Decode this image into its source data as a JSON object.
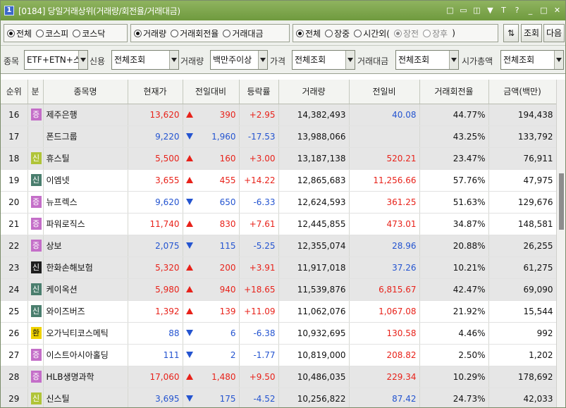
{
  "title": {
    "num": "1",
    "text": "[0184] 당일거래상위(거래량/회전율/거래대금)"
  },
  "title_icons": [
    "□",
    "▭",
    "◫",
    "▼",
    "T",
    "?",
    "_",
    "□",
    "✕"
  ],
  "market_radios": [
    {
      "label": "전체",
      "checked": true
    },
    {
      "label": "코스피",
      "checked": false
    },
    {
      "label": "코스닥",
      "checked": false
    }
  ],
  "sort_radios": [
    {
      "label": "거래량",
      "checked": true
    },
    {
      "label": "거래회전율",
      "checked": false
    },
    {
      "label": "거래대금",
      "checked": false
    }
  ],
  "session_radios": [
    {
      "label": "전체",
      "checked": true
    },
    {
      "label": "장중",
      "checked": false
    },
    {
      "label": "시간외(",
      "checked": false
    }
  ],
  "afterhours_radios": [
    {
      "label": "장전",
      "checked": true
    },
    {
      "label": "장후",
      "checked": false
    }
  ],
  "afterhours_close": ")",
  "buttons": {
    "sort": "⇅",
    "query": "조회",
    "next": "다음"
  },
  "filters": {
    "stock_label": "종목",
    "stock_value": "ETF+ETN+스",
    "credit_label": "신용",
    "credit_value": "전체조회",
    "volume_label": "거래량",
    "volume_value": "백만주이상",
    "price_label": "가격",
    "price_value": "전체조회",
    "amount_label": "거래대금",
    "amount_value": "전체조회",
    "cap_label": "시가총액",
    "cap_value": "전체조회"
  },
  "columns": [
    "순위",
    "분",
    "종목명",
    "현재가",
    "전일대비",
    "등락률",
    "거래량",
    "전일비",
    "거래회전율",
    "금액(백만)"
  ],
  "rows": [
    {
      "rank": "16",
      "badge": "증",
      "badge_type": "jeung",
      "name": "제주은행",
      "price": "13,620",
      "dir": "up",
      "change": "390",
      "rate": "+2.95",
      "volume": "14,382,493",
      "prev": "40.08",
      "prev_dir": "dn",
      "turnover": "44.77%",
      "amount": "194,438",
      "shade": "g"
    },
    {
      "rank": "17",
      "badge": "",
      "badge_type": "",
      "name": "폰드그룹",
      "price": "9,220",
      "dir": "dn",
      "change": "1,960",
      "rate": "-17.53",
      "volume": "13,988,066",
      "prev": "",
      "prev_dir": "",
      "turnover": "43.25%",
      "amount": "133,792",
      "shade": "g"
    },
    {
      "rank": "18",
      "badge": "신",
      "badge_type": "sin3",
      "name": "휴스틸",
      "price": "5,500",
      "dir": "up",
      "change": "160",
      "rate": "+3.00",
      "volume": "13,187,138",
      "prev": "520.21",
      "prev_dir": "up",
      "turnover": "23.47%",
      "amount": "76,911",
      "shade": "g"
    },
    {
      "rank": "19",
      "badge": "신",
      "badge_type": "sin",
      "name": "이엠넷",
      "price": "3,655",
      "dir": "up",
      "change": "455",
      "rate": "+14.22",
      "volume": "12,865,683",
      "prev": "11,256.66",
      "prev_dir": "up",
      "turnover": "57.76%",
      "amount": "47,975",
      "shade": "w"
    },
    {
      "rank": "20",
      "badge": "증",
      "badge_type": "jeung",
      "name": "뉴프렉스",
      "price": "9,620",
      "dir": "dn",
      "change": "650",
      "rate": "-6.33",
      "volume": "12,624,593",
      "prev": "361.25",
      "prev_dir": "up",
      "turnover": "51.63%",
      "amount": "129,676",
      "shade": "w"
    },
    {
      "rank": "21",
      "badge": "증",
      "badge_type": "jeung",
      "name": "파워로직스",
      "price": "11,740",
      "dir": "up",
      "change": "830",
      "rate": "+7.61",
      "volume": "12,445,855",
      "prev": "473.01",
      "prev_dir": "up",
      "turnover": "34.87%",
      "amount": "148,581",
      "shade": "w"
    },
    {
      "rank": "22",
      "badge": "증",
      "badge_type": "jeung",
      "name": "상보",
      "price": "2,075",
      "dir": "dn",
      "change": "115",
      "rate": "-5.25",
      "volume": "12,355,074",
      "prev": "28.96",
      "prev_dir": "dn",
      "turnover": "20.88%",
      "amount": "26,255",
      "shade": "g"
    },
    {
      "rank": "23",
      "badge": "신",
      "badge_type": "sin2",
      "name": "한화손해보험",
      "price": "5,320",
      "dir": "up",
      "change": "200",
      "rate": "+3.91",
      "volume": "11,917,018",
      "prev": "37.26",
      "prev_dir": "dn",
      "turnover": "10.21%",
      "amount": "61,275",
      "shade": "g"
    },
    {
      "rank": "24",
      "badge": "신",
      "badge_type": "sin",
      "name": "케이옥션",
      "price": "5,980",
      "dir": "up",
      "change": "940",
      "rate": "+18.65",
      "volume": "11,539,876",
      "prev": "6,815.67",
      "prev_dir": "up",
      "turnover": "42.47%",
      "amount": "69,090",
      "shade": "g"
    },
    {
      "rank": "25",
      "badge": "신",
      "badge_type": "sin",
      "name": "와이즈버즈",
      "price": "1,392",
      "dir": "up",
      "change": "139",
      "rate": "+11.09",
      "volume": "11,062,076",
      "prev": "1,067.08",
      "prev_dir": "up",
      "turnover": "21.92%",
      "amount": "15,544",
      "shade": "w"
    },
    {
      "rank": "26",
      "badge": "환",
      "badge_type": "hwan",
      "name": "오가닉티코스메틱",
      "price": "88",
      "dir": "dn",
      "change": "6",
      "rate": "-6.38",
      "volume": "10,932,695",
      "prev": "130.58",
      "prev_dir": "up",
      "turnover": "4.46%",
      "amount": "992",
      "shade": "w"
    },
    {
      "rank": "27",
      "badge": "증",
      "badge_type": "jeung",
      "name": "이스트아시아홀딩",
      "price": "111",
      "dir": "dn",
      "change": "2",
      "rate": "-1.77",
      "volume": "10,819,000",
      "prev": "208.82",
      "prev_dir": "up",
      "turnover": "2.50%",
      "amount": "1,202",
      "shade": "w"
    },
    {
      "rank": "28",
      "badge": "증",
      "badge_type": "jeung",
      "name": "HLB생명과학",
      "price": "17,060",
      "dir": "up",
      "change": "1,480",
      "rate": "+9.50",
      "volume": "10,486,035",
      "prev": "229.34",
      "prev_dir": "up",
      "turnover": "10.29%",
      "amount": "178,692",
      "shade": "g"
    },
    {
      "rank": "29",
      "badge": "신",
      "badge_type": "sin3",
      "name": "신스틸",
      "price": "3,695",
      "dir": "dn",
      "change": "175",
      "rate": "-4.52",
      "volume": "10,256,822",
      "prev": "87.42",
      "prev_dir": "dn",
      "turnover": "24.73%",
      "amount": "42,033",
      "shade": "g"
    }
  ],
  "colors": {
    "up": "#e8221a",
    "down": "#2454d0",
    "titlebar": "#7ea54f"
  }
}
